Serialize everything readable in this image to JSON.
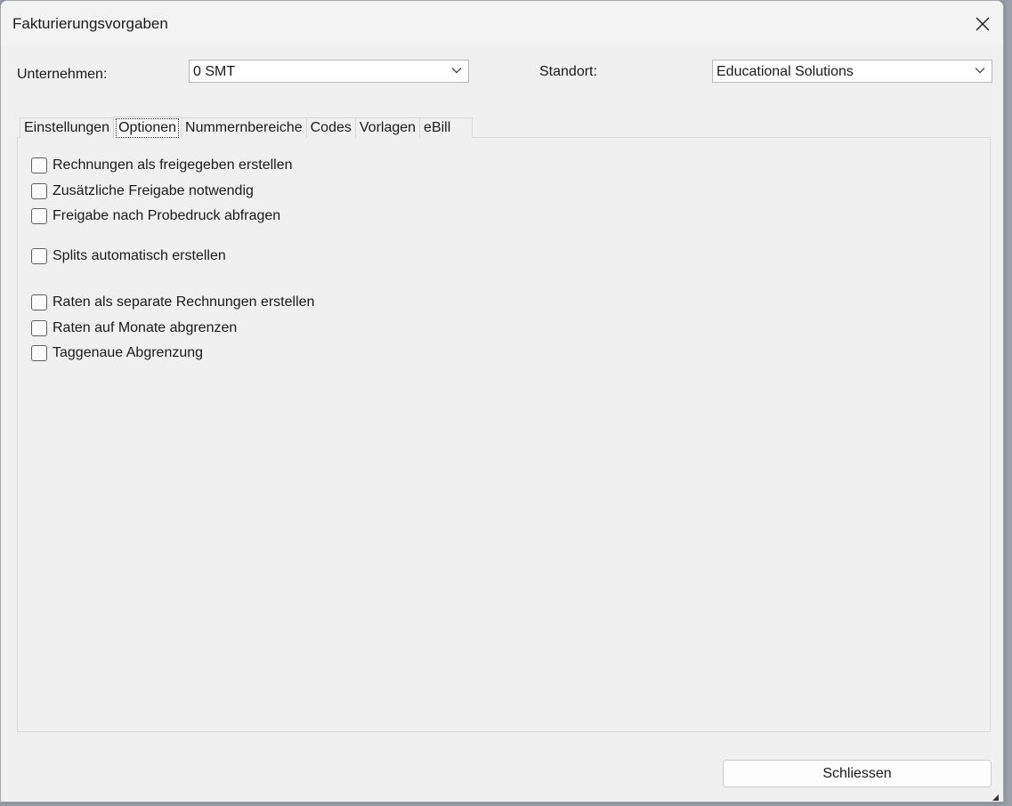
{
  "window": {
    "title": "Fakturierungsvorgaben"
  },
  "header": {
    "company_label": "Unternehmen:",
    "company_value": "0 SMT",
    "location_label": "Standort:",
    "location_value": "Educational Solutions"
  },
  "tabs": [
    {
      "label": "Einstellungen",
      "active": false
    },
    {
      "label": "Optionen",
      "active": true
    },
    {
      "label": "Nummernbereiche",
      "active": false
    },
    {
      "label": "Codes",
      "active": false
    },
    {
      "label": "Vorlagen",
      "active": false
    },
    {
      "label": "eBill",
      "active": false
    }
  ],
  "options": [
    {
      "label": "Rechnungen als freigegeben erstellen",
      "checked": false
    },
    {
      "label": "Zusätzliche Freigabe notwendig",
      "checked": false
    },
    {
      "label": "Freigabe nach Probedruck abfragen",
      "checked": false
    },
    {
      "label": "Splits automatisch erstellen",
      "checked": false
    },
    {
      "label": "Raten als separate Rechnungen erstellen",
      "checked": false
    },
    {
      "label": "Raten auf Monate abgrenzen",
      "checked": false
    },
    {
      "label": "Taggenaue Abgrenzung",
      "checked": false
    }
  ],
  "footer": {
    "close_label": "Schliessen"
  },
  "icons": {
    "close": "close-icon",
    "dropdown": "chevron-down-icon"
  }
}
